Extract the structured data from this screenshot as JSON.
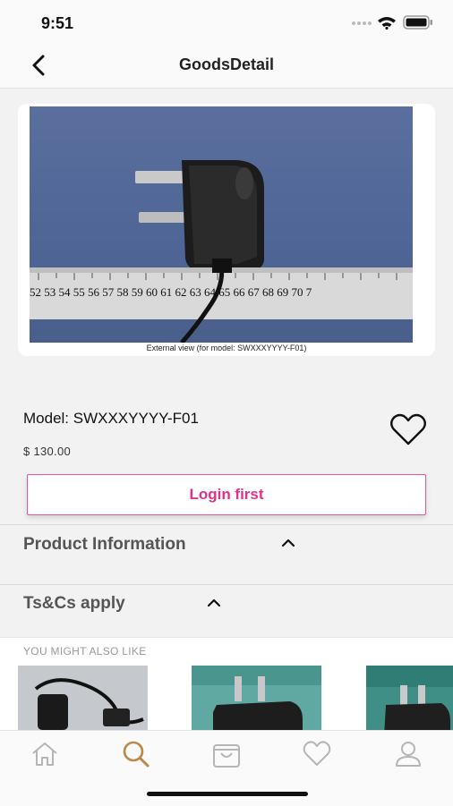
{
  "status_bar": {
    "time": "9:51"
  },
  "nav": {
    "title": "GoodsDetail"
  },
  "product": {
    "image_caption": "External view (for model: SWXXXYYYY-F01)",
    "ruler_numbers": "52 53 54 55 56 57 58 59 60 61 62 63 64 65 66 67 68 69 70 7",
    "model": "Model: SWXXXYYYY-F01",
    "price": "$ 130.00",
    "login_button": "Login first"
  },
  "sections": [
    {
      "title": "Product Information"
    },
    {
      "title": "Ts&Cs apply"
    }
  ],
  "recommendations": {
    "title": "YOU MIGHT ALSO LIKE"
  },
  "tabbar": {
    "items": [
      "home-icon",
      "search-icon",
      "cart-icon",
      "heart-icon",
      "user-icon"
    ],
    "active": "search-icon"
  },
  "colors": {
    "accent": "#e0328a",
    "active_tab": "#b8894a",
    "inactive_tab": "#b5b5b5"
  }
}
